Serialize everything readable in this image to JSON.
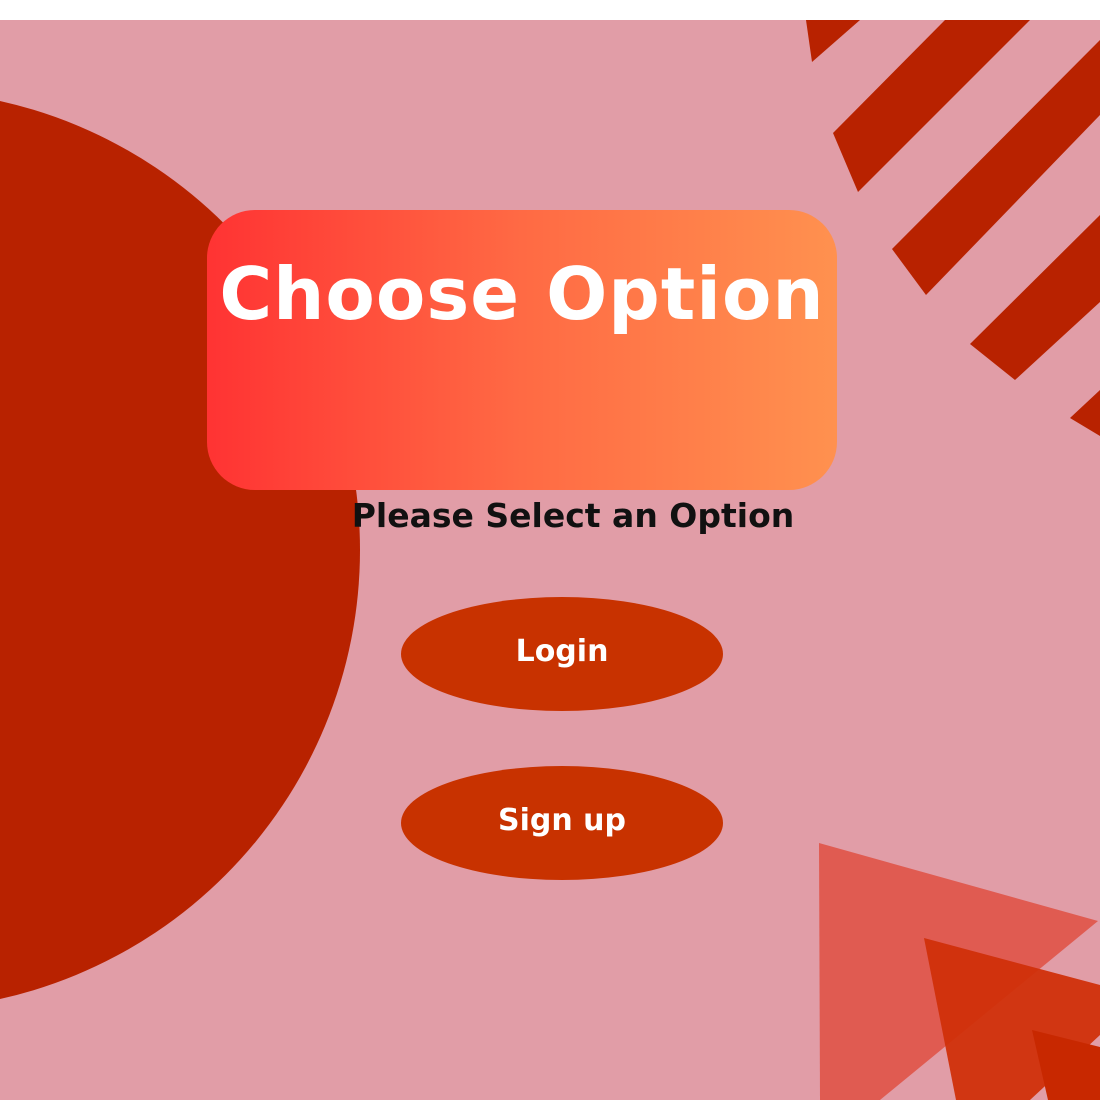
{
  "header": {
    "title": "Choose Option"
  },
  "main": {
    "subtitle": "Please Select an Option",
    "buttons": {
      "login_label": "Login",
      "signup_label": "Sign up"
    }
  },
  "colors": {
    "background": "#e19da7",
    "dark_red": "#b82200",
    "button_red": "#c83200",
    "gradient_start": "#ff3333",
    "gradient_end": "#ff914f",
    "triangle_light": "#e0564a",
    "triangle_dark": "#d0300a"
  }
}
